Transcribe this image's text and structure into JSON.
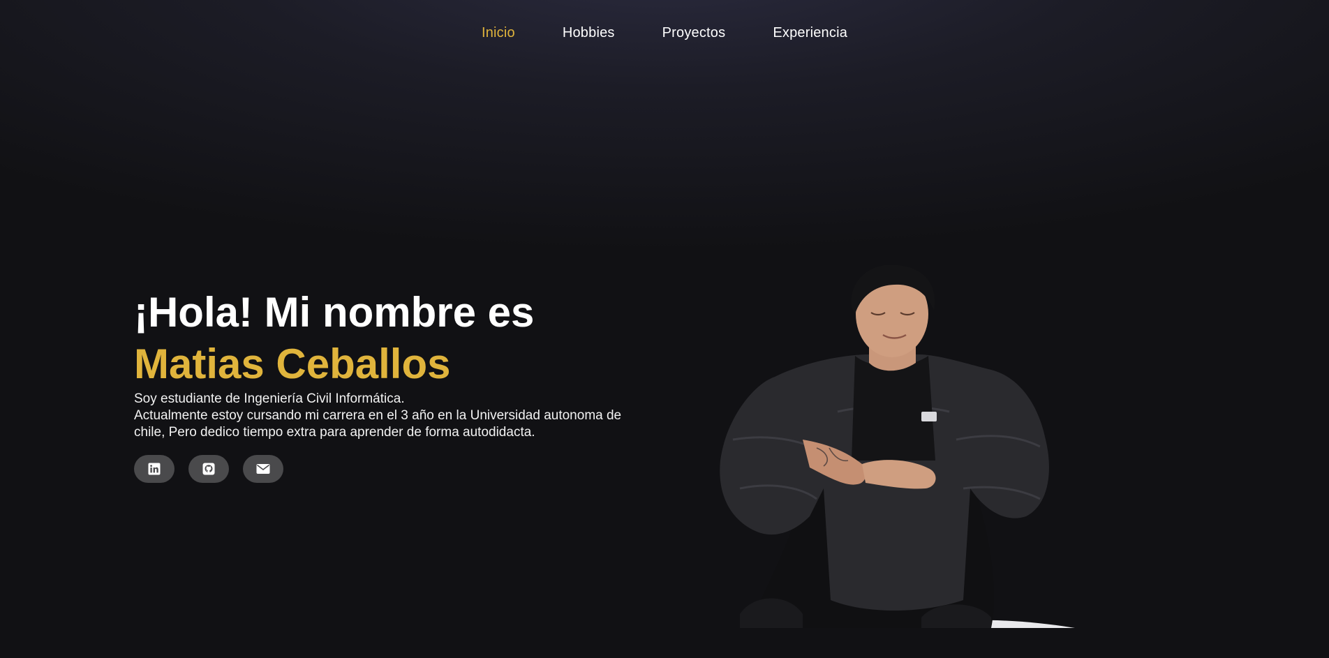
{
  "nav": {
    "items": [
      {
        "label": "Inicio",
        "active": true
      },
      {
        "label": "Hobbies",
        "active": false
      },
      {
        "label": "Proyectos",
        "active": false
      },
      {
        "label": "Experiencia",
        "active": false
      }
    ]
  },
  "hero": {
    "greeting": "¡Hola! Mi nombre es",
    "name": "Matias Ceballos",
    "bio_line1": "Soy estudiante de Ingeniería Civil Informática.",
    "bio_line2": "Actualmente estoy cursando mi carrera en el 3 año en la Universidad autonoma de chile, Pero dedico tiempo extra para aprender de forma autodidacta."
  },
  "socials": [
    {
      "icon": "linkedin-icon"
    },
    {
      "icon": "github-icon"
    },
    {
      "icon": "mail-icon"
    }
  ],
  "colors": {
    "accent": "#e0b43c",
    "background": "#111113",
    "button": "#4a4a4c"
  }
}
